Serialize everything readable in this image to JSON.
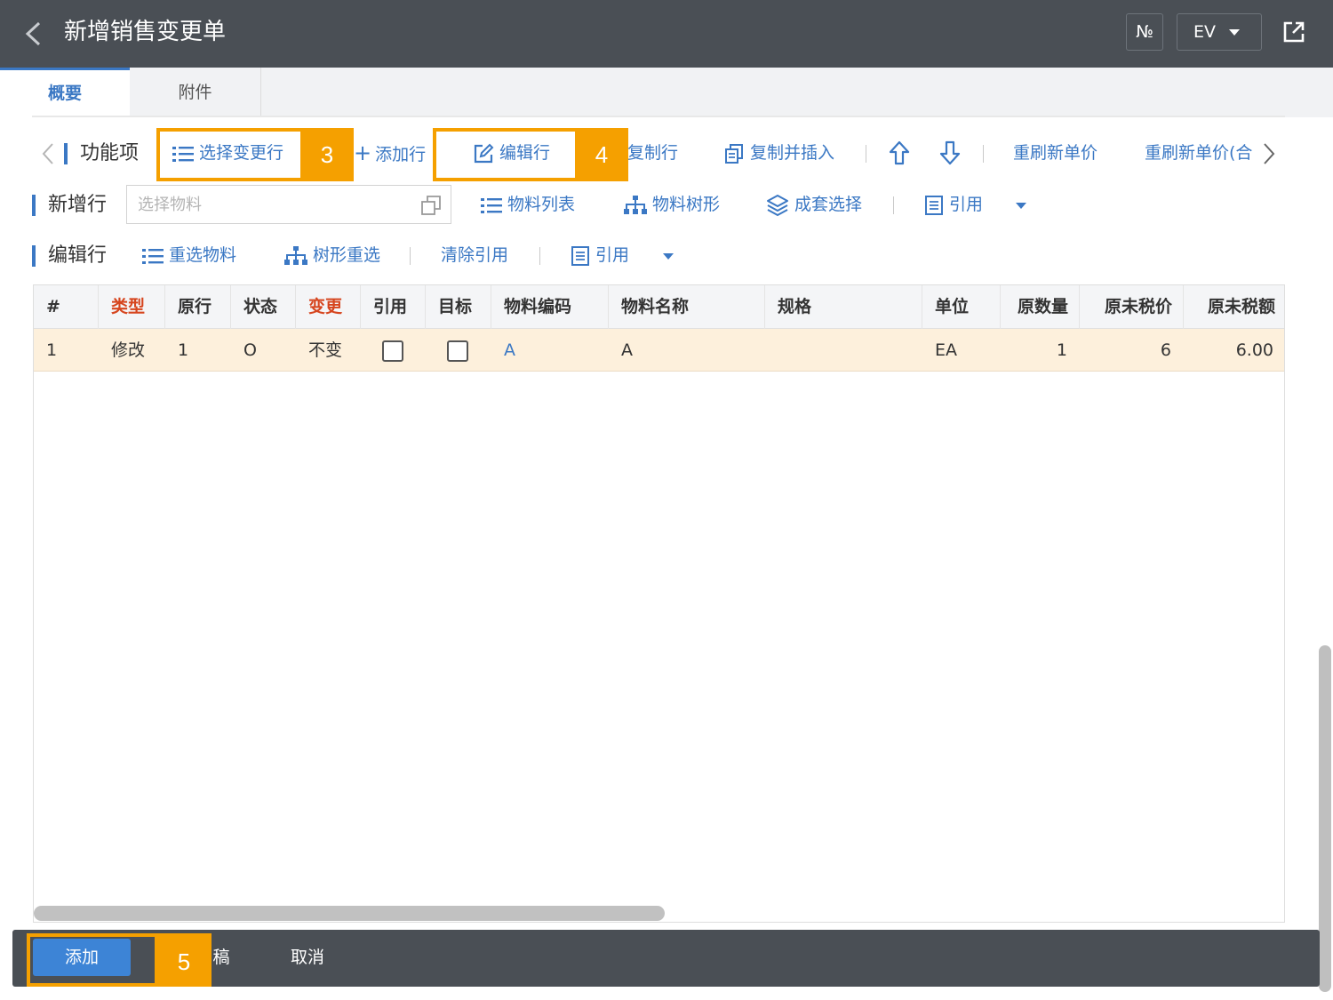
{
  "header": {
    "title": "新增销售变更单",
    "no_label": "№",
    "ev_label": "EV"
  },
  "tabs": [
    {
      "label": "概要"
    },
    {
      "label": "附件"
    }
  ],
  "toolbar": {
    "label": "功能项",
    "select_change_rows": "选择变更行",
    "add_row": "添加行",
    "edit_row": "编辑行",
    "copy_row": "复制行",
    "copy_insert": "复制并插入",
    "refresh_price": "重刷新单价",
    "refresh_price_2": "重刷新单价(合"
  },
  "new_row": {
    "label": "新增行",
    "search_placeholder": "选择物料",
    "material_list": "物料列表",
    "material_tree": "物料树形",
    "kit_select": "成套选择",
    "reference": "引用"
  },
  "edit_row": {
    "label": "编辑行",
    "reselect_material": "重选物料",
    "tree_reselect": "树形重选",
    "clear_reference": "清除引用",
    "reference": "引用"
  },
  "table": {
    "columns": [
      "#",
      "类型",
      "原行",
      "状态",
      "变更",
      "引用",
      "目标",
      "物料编码",
      "物料名称",
      "规格",
      "单位",
      "原数量",
      "原未税价",
      "原未税额"
    ],
    "rows": [
      {
        "index": "1",
        "type": "修改",
        "orig_row": "1",
        "status": "O",
        "change": "不变",
        "ref": false,
        "target": false,
        "code": "A",
        "name": "A",
        "spec": "",
        "unit": "EA",
        "qty": "1",
        "price": "6",
        "amount": "6.00"
      }
    ]
  },
  "footer": {
    "add": "添加",
    "draft": "稿",
    "cancel": "取消"
  },
  "annotations": [
    "3",
    "4",
    "5"
  ],
  "colors": {
    "header_bg": "#4a4f55",
    "accent": "#3b78c4",
    "highlight": "#f5a000",
    "row_bg": "#fdf0dc",
    "required": "#d6451e"
  }
}
